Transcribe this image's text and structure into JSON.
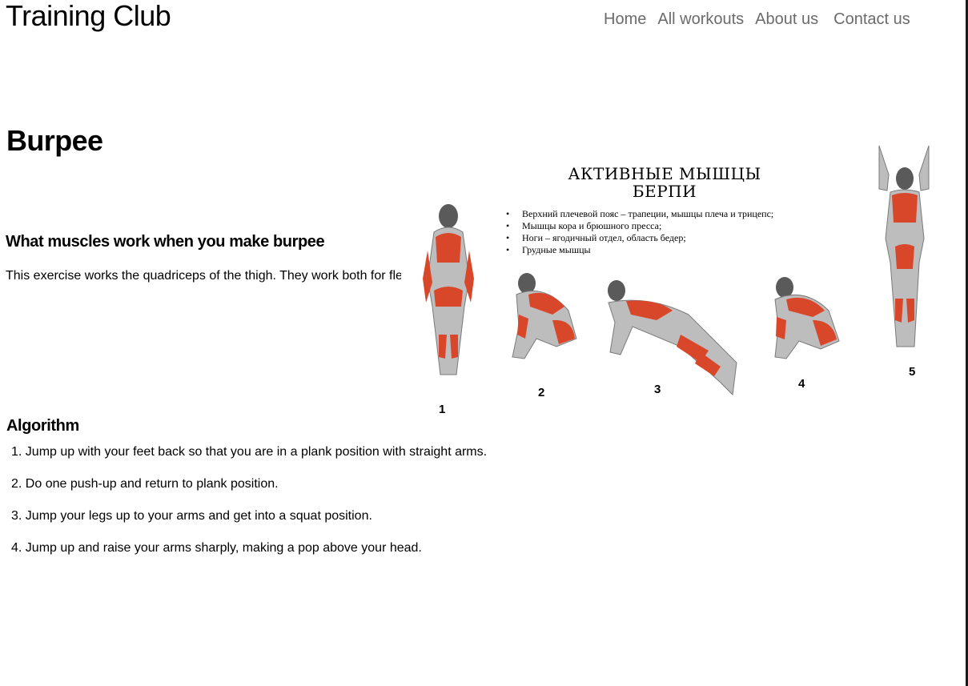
{
  "header": {
    "brand": "Training Club",
    "nav": [
      "Home",
      "All workouts",
      "About us",
      "Contact us"
    ]
  },
  "page": {
    "title": "Burpee",
    "muscles_heading": "What muscles work when you make burpee",
    "muscles_text": "This exercise works the quadriceps of the thigh. They work both for flexion and extension; - biceps"
  },
  "image": {
    "title_line1": "АКТИВНЫЕ МЫШЦЫ",
    "title_line2": "БЕРПИ",
    "bullets": [
      "Верхний плечевой пояс – трапеции, мышцы плеча и трицепс;",
      "Мышцы кора и брюшного пресса;",
      "Ноги – ягодичный отдел, область бедер;",
      "Грудные мышцы"
    ],
    "step_numbers": [
      "1",
      "2",
      "3",
      "4",
      "5"
    ]
  },
  "algorithm": {
    "heading": "Algorithm",
    "steps": [
      "1. Jump up with your feet back so that you are in a plank position with straight arms.",
      "2. Do one push-up and return to plank position.",
      "3. Jump your legs up to your arms and get into a squat position.",
      "4. Jump up and raise your arms sharply, making a pop above your head."
    ]
  },
  "colors": {
    "muscle_red": "#d9472b",
    "body_gray": "#bdbdbd",
    "nav_gray": "#6b6b6b"
  }
}
